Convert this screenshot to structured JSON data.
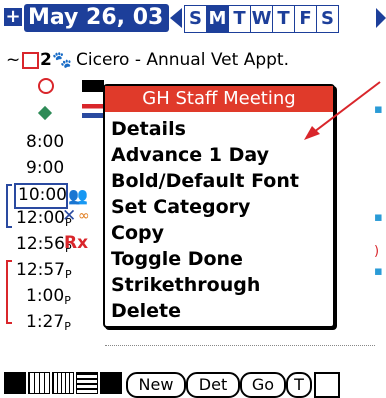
{
  "header": {
    "cal_icon_glyph": "+",
    "date_title": "May 26, 03",
    "days": [
      "S",
      "M",
      "T",
      "W",
      "T",
      "F",
      "S"
    ],
    "selected_day_index": 1
  },
  "entries": {
    "first_item_prefix": "~",
    "first_item_count": "2",
    "first_item_text": "Cicero - Annual Vet Appt.",
    "times": [
      "8:00",
      "9:00",
      "10:00",
      "12:00",
      "12:56",
      "12:57",
      "1:00",
      "1:27"
    ],
    "pm_marker": "P",
    "rx_text": "Rx"
  },
  "menu": {
    "title": "GH Staff Meeting",
    "items": [
      "Details",
      "Advance 1 Day",
      "Bold/Default Font",
      "Set Category",
      "Copy",
      "Toggle Done",
      "Strikethrough",
      "Delete"
    ]
  },
  "toolbar": {
    "new_label": "New",
    "details_label": "Det",
    "go_label": "Go",
    "t_label": "T"
  },
  "colors": {
    "brand_blue": "#1d3f9a",
    "menu_red": "#e03a2a",
    "accent_red": "#d9262b",
    "accent_blue": "#2a9bd6"
  }
}
